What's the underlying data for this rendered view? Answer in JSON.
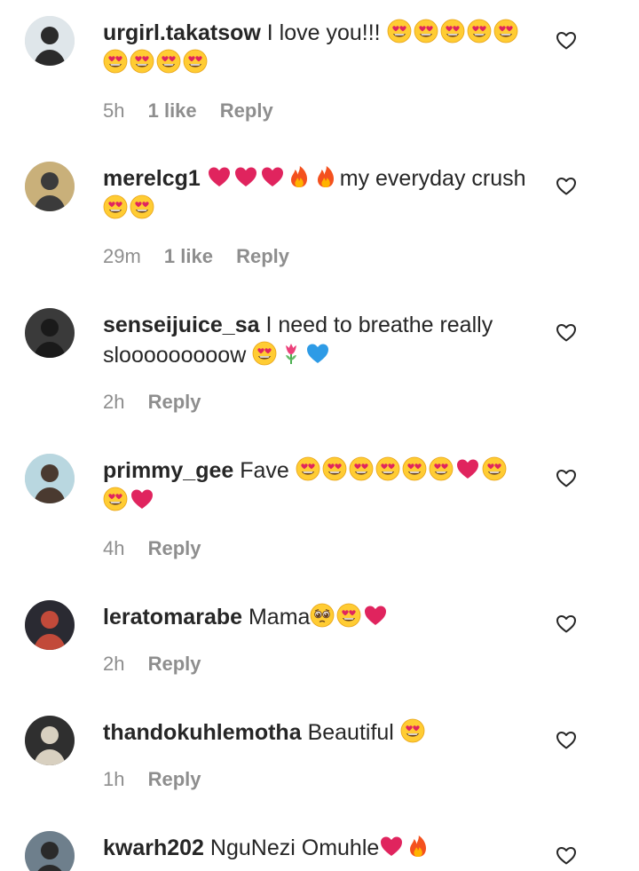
{
  "comments": [
    {
      "username": "urgirl.takatsow",
      "text": "I love you!!!",
      "emojis": [
        "heart-eyes",
        "heart-eyes",
        "heart-eyes",
        "heart-eyes",
        "heart-eyes",
        "heart-eyes",
        "heart-eyes",
        "heart-eyes",
        "heart-eyes"
      ],
      "time": "5h",
      "likes": "1 like",
      "reply": "Reply",
      "avatar_colors": [
        "#dfe6ea",
        "#2b2b2b"
      ]
    },
    {
      "username": "merelcg1",
      "text_before": "",
      "emojis_before": [
        "red-heart",
        "red-heart",
        "red-heart",
        "fire",
        "fire"
      ],
      "text": "my everyday crush",
      "emojis": [
        "heart-eyes",
        "heart-eyes"
      ],
      "time": "29m",
      "likes": "1 like",
      "reply": "Reply",
      "avatar_colors": [
        "#c9b07a",
        "#3b3b3b"
      ]
    },
    {
      "username": "senseijuice_sa",
      "text": "I need to breathe really slooooooooow",
      "emojis": [
        "heart-eyes",
        "tulip",
        "blue-heart"
      ],
      "time": "2h",
      "likes": "",
      "reply": "Reply",
      "avatar_colors": [
        "#3a3a3a",
        "#1a1a1a"
      ]
    },
    {
      "username": "primmy_gee",
      "text": "Fave",
      "emojis": [
        "heart-eyes",
        "heart-eyes",
        "heart-eyes",
        "heart-eyes",
        "heart-eyes",
        "heart-eyes",
        "red-heart",
        "heart-eyes",
        "heart-eyes",
        "red-heart"
      ],
      "time": "4h",
      "likes": "",
      "reply": "Reply",
      "avatar_colors": [
        "#b9d7e0",
        "#4a3a30"
      ]
    },
    {
      "username": "leratomarabe",
      "text": "Mama",
      "emojis": [
        "pleading",
        "heart-eyes",
        "red-heart"
      ],
      "time": "2h",
      "likes": "",
      "reply": "Reply",
      "avatar_colors": [
        "#2a2a32",
        "#c24a3a"
      ]
    },
    {
      "username": "thandokuhlemotha",
      "text": "Beautiful",
      "emojis": [
        "heart-eyes"
      ],
      "time": "1h",
      "likes": "",
      "reply": "Reply",
      "avatar_colors": [
        "#2f2f2f",
        "#d8d0c0"
      ]
    },
    {
      "username": "kwarh202",
      "text": "NguNezi Omuhle",
      "emojis": [
        "red-heart",
        "fire"
      ],
      "time": "",
      "likes": "",
      "reply": "",
      "avatar_colors": [
        "#6e7f8c",
        "#2a2a2a"
      ]
    }
  ],
  "icons": {
    "like": "heart-outline-icon"
  },
  "colors": {
    "text": "#262626",
    "meta": "#8e8e8e"
  }
}
